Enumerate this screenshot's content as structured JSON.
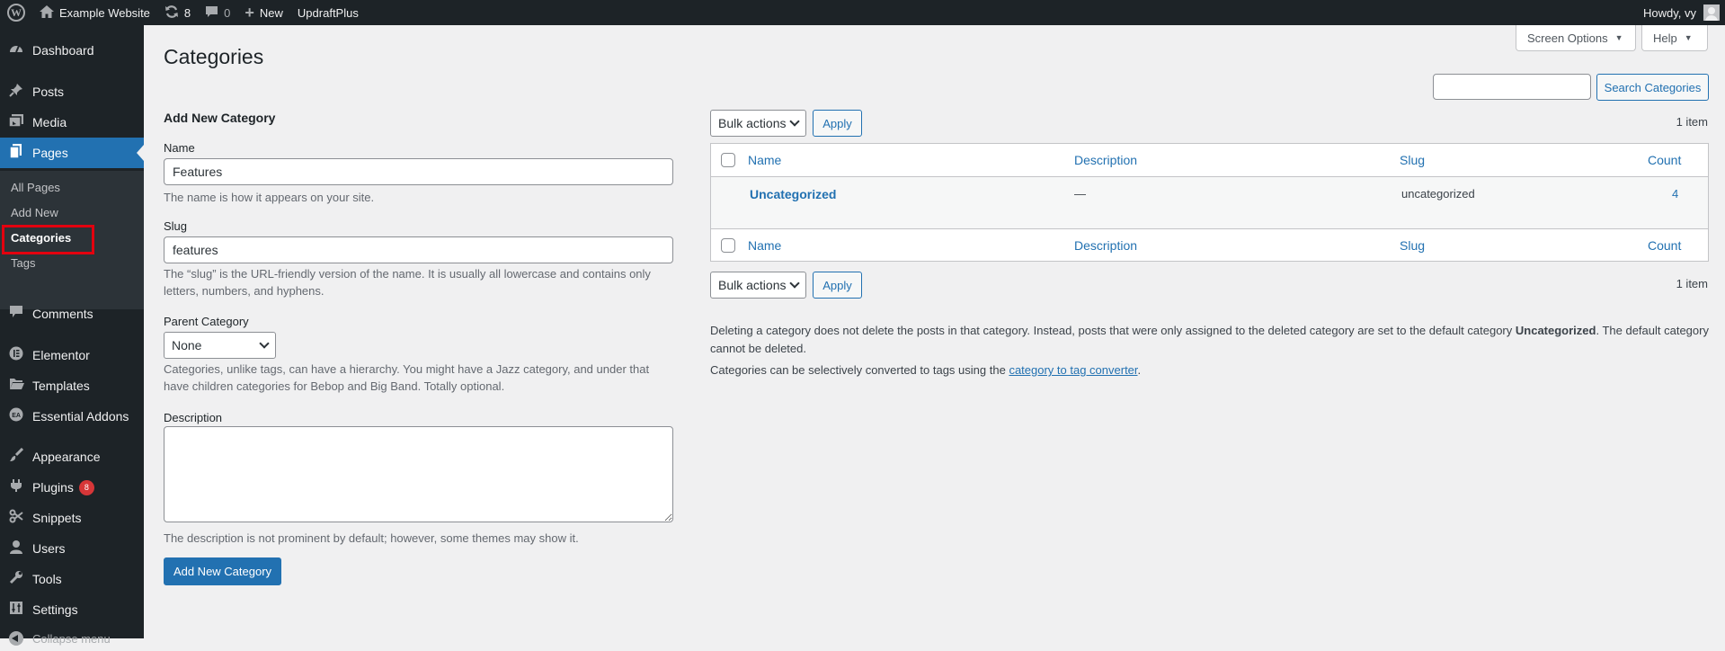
{
  "adminbar": {
    "site_name": "Example Website",
    "updates_count": "8",
    "comments_count": "0",
    "new_label": "New",
    "updraft_label": "UpdraftPlus",
    "howdy": "Howdy, vy"
  },
  "menu": {
    "dashboard": "Dashboard",
    "posts": "Posts",
    "media": "Media",
    "pages": "Pages",
    "sub_all_pages": "All Pages",
    "sub_add_new": "Add New",
    "sub_categories": "Categories",
    "sub_tags": "Tags",
    "comments": "Comments",
    "elementor": "Elementor",
    "templates": "Templates",
    "essential_addons": "Essential Addons",
    "appearance": "Appearance",
    "plugins": "Plugins",
    "plugins_badge": "8",
    "snippets": "Snippets",
    "users": "Users",
    "tools": "Tools",
    "settings": "Settings",
    "collapse": "Collapse menu"
  },
  "top_buttons": {
    "screen_options": "Screen Options",
    "help": "Help"
  },
  "page": {
    "title": "Categories",
    "search_button": "Search Categories"
  },
  "form": {
    "heading": "Add New Category",
    "name_label": "Name",
    "name_value": "Features",
    "name_help": "The name is how it appears on your site.",
    "slug_label": "Slug",
    "slug_value": "features",
    "slug_help": "The “slug” is the URL-friendly version of the name. It is usually all lowercase and contains only letters, numbers, and hyphens.",
    "parent_label": "Parent Category",
    "parent_value": "None",
    "parent_help": "Categories, unlike tags, can have a hierarchy. You might have a Jazz category, and under that have children categories for Bebop and Big Band. Totally optional.",
    "desc_label": "Description",
    "desc_help": "The description is not prominent by default; however, some themes may show it.",
    "submit": "Add New Category"
  },
  "list": {
    "bulk_actions": "Bulk actions",
    "apply": "Apply",
    "items_count": "1 item",
    "columns": [
      "Name",
      "Description",
      "Slug",
      "Count"
    ],
    "rows": [
      {
        "name": "Uncategorized",
        "description": "—",
        "slug": "uncategorized",
        "count": "4"
      }
    ]
  },
  "notes": {
    "delete_note_1": "Deleting a category does not delete the posts in that category. Instead, posts that were only assigned to the deleted category are set to the default category",
    "delete_note_bold": "Uncategorized",
    "delete_note_2": ". The default category cannot be deleted.",
    "convert_note": "Categories can be selectively converted to tags using the",
    "convert_link": "category to tag converter",
    "convert_end": "."
  }
}
